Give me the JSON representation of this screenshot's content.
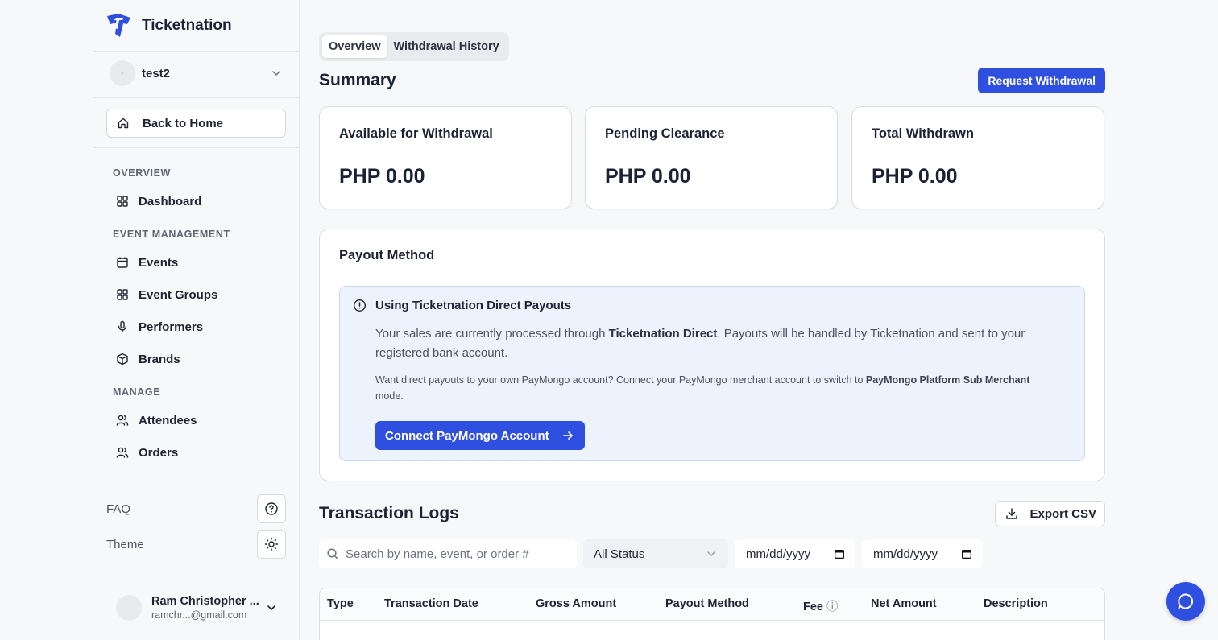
{
  "brand": {
    "name": "Ticketnation",
    "accent": "#2f4fe0"
  },
  "org": {
    "name": "test2"
  },
  "sidebar": {
    "back_label": "Back to Home",
    "sections": [
      {
        "title": "OVERVIEW",
        "items": [
          {
            "label": "Dashboard",
            "icon": "grid-icon"
          }
        ]
      },
      {
        "title": "EVENT MANAGEMENT",
        "items": [
          {
            "label": "Events",
            "icon": "calendar-icon"
          },
          {
            "label": "Event Groups",
            "icon": "grid-icon"
          },
          {
            "label": "Performers",
            "icon": "microphone-icon"
          },
          {
            "label": "Brands",
            "icon": "box-icon"
          }
        ]
      },
      {
        "title": "MANAGE",
        "items": [
          {
            "label": "Attendees",
            "icon": "users-icon"
          },
          {
            "label": "Orders",
            "icon": "users-icon"
          }
        ]
      }
    ],
    "faq_label": "FAQ",
    "theme_label": "Theme"
  },
  "user": {
    "name": "Ram Christopher ...",
    "email": "ramchr...@gmail.com"
  },
  "tabs": [
    "Overview",
    "Withdrawal History"
  ],
  "summary": {
    "title": "Summary",
    "request_button": "Request Withdrawal",
    "stats": [
      {
        "label": "Available for Withdrawal",
        "value": "PHP 0.00"
      },
      {
        "label": "Pending Clearance",
        "value": "PHP 0.00"
      },
      {
        "label": "Total Withdrawn",
        "value": "PHP 0.00"
      }
    ]
  },
  "payout": {
    "title": "Payout Method",
    "alert_title": "Using Ticketnation Direct Payouts",
    "p1_before": "Your sales are currently processed through ",
    "p1_bold": "Ticketnation Direct",
    "p1_after": ". Payouts will be handled by Ticketnation and sent to your registered bank account.",
    "p2_before": "Want direct payouts to your own PayMongo account? Connect your PayMongo merchant account to switch to ",
    "p2_bold": "PayMongo Platform Sub Merchant",
    "p2_after": " mode.",
    "connect_button": "Connect PayMongo Account"
  },
  "logs": {
    "title": "Transaction Logs",
    "export_button": "Export CSV",
    "search_placeholder": "Search by name, event, or order #",
    "status_selected": "All Status",
    "date_from": "mm/dd/yyyy",
    "date_to": "mm/dd/yyyy",
    "columns": [
      "Type",
      "Transaction Date",
      "Gross Amount",
      "Payout Method",
      "Fee",
      "Net Amount",
      "Description"
    ],
    "fee_info_glyph": "ⓘ"
  }
}
